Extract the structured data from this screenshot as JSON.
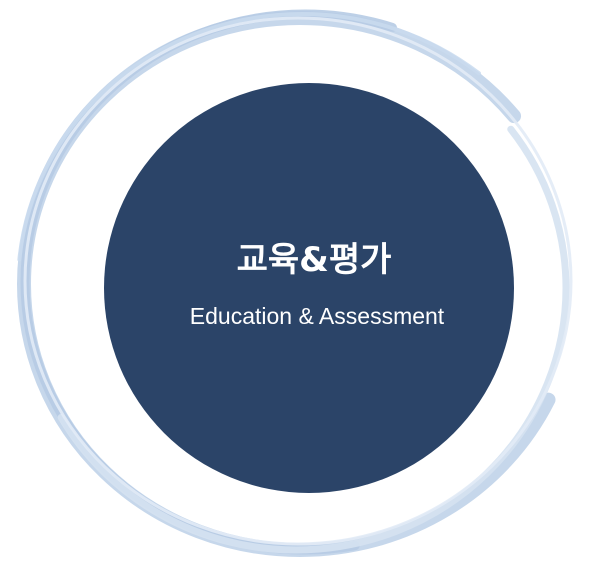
{
  "graphic": {
    "title_korean": "교육&평가",
    "title_english": "Education & Assessment"
  },
  "colors": {
    "center_fill": "#2b4468",
    "ring_stroke": "#b9cde6",
    "ring_stroke_light": "#d7e3f2",
    "text": "#ffffff",
    "background": "#ffffff"
  }
}
